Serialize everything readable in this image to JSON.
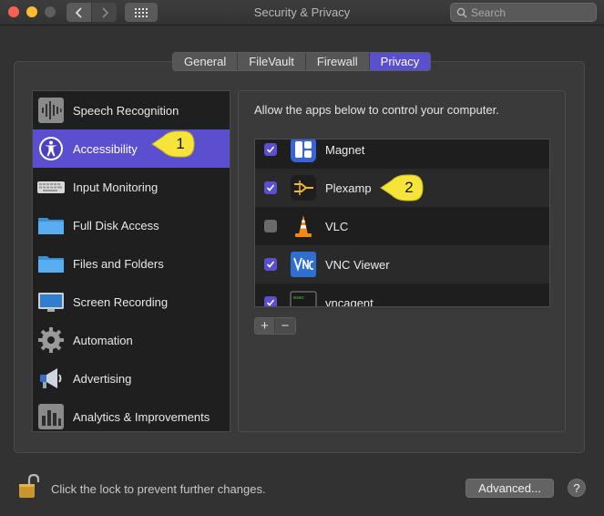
{
  "window": {
    "title": "Security & Privacy",
    "search_placeholder": "Search"
  },
  "tabs": [
    {
      "label": "General",
      "active": false
    },
    {
      "label": "FileVault",
      "active": false
    },
    {
      "label": "Firewall",
      "active": false
    },
    {
      "label": "Privacy",
      "active": true
    }
  ],
  "sidebar": {
    "items": [
      {
        "label": "Speech Recognition",
        "icon": "waveform-icon"
      },
      {
        "label": "Accessibility",
        "icon": "accessibility-icon",
        "active": true
      },
      {
        "label": "Input Monitoring",
        "icon": "keyboard-icon"
      },
      {
        "label": "Full Disk Access",
        "icon": "folder-icon"
      },
      {
        "label": "Files and Folders",
        "icon": "folder-icon"
      },
      {
        "label": "Screen Recording",
        "icon": "display-icon"
      },
      {
        "label": "Automation",
        "icon": "gear-icon"
      },
      {
        "label": "Advertising",
        "icon": "megaphone-icon"
      },
      {
        "label": "Analytics & Improvements",
        "icon": "bar-chart-icon"
      }
    ]
  },
  "main": {
    "allow_text": "Allow the apps below to control your computer.",
    "apps": [
      {
        "name": "Magnet",
        "checked": true,
        "icon": "magnet-icon"
      },
      {
        "name": "Plexamp",
        "checked": true,
        "icon": "plexamp-icon"
      },
      {
        "name": "VLC",
        "checked": false,
        "icon": "vlc-cone-icon"
      },
      {
        "name": "VNC Viewer",
        "checked": true,
        "icon": "vnc-icon"
      },
      {
        "name": "vncagent",
        "checked": true,
        "icon": "terminal-icon"
      }
    ],
    "add_label": "+",
    "remove_label": "−"
  },
  "callouts": [
    {
      "number": "1"
    },
    {
      "number": "2"
    }
  ],
  "footer": {
    "lock_text": "Click the lock to prevent further changes.",
    "advanced_label": "Advanced...",
    "help_label": "?"
  },
  "colors": {
    "accent": "#5a4fcf",
    "callout": "#f7e43a"
  }
}
